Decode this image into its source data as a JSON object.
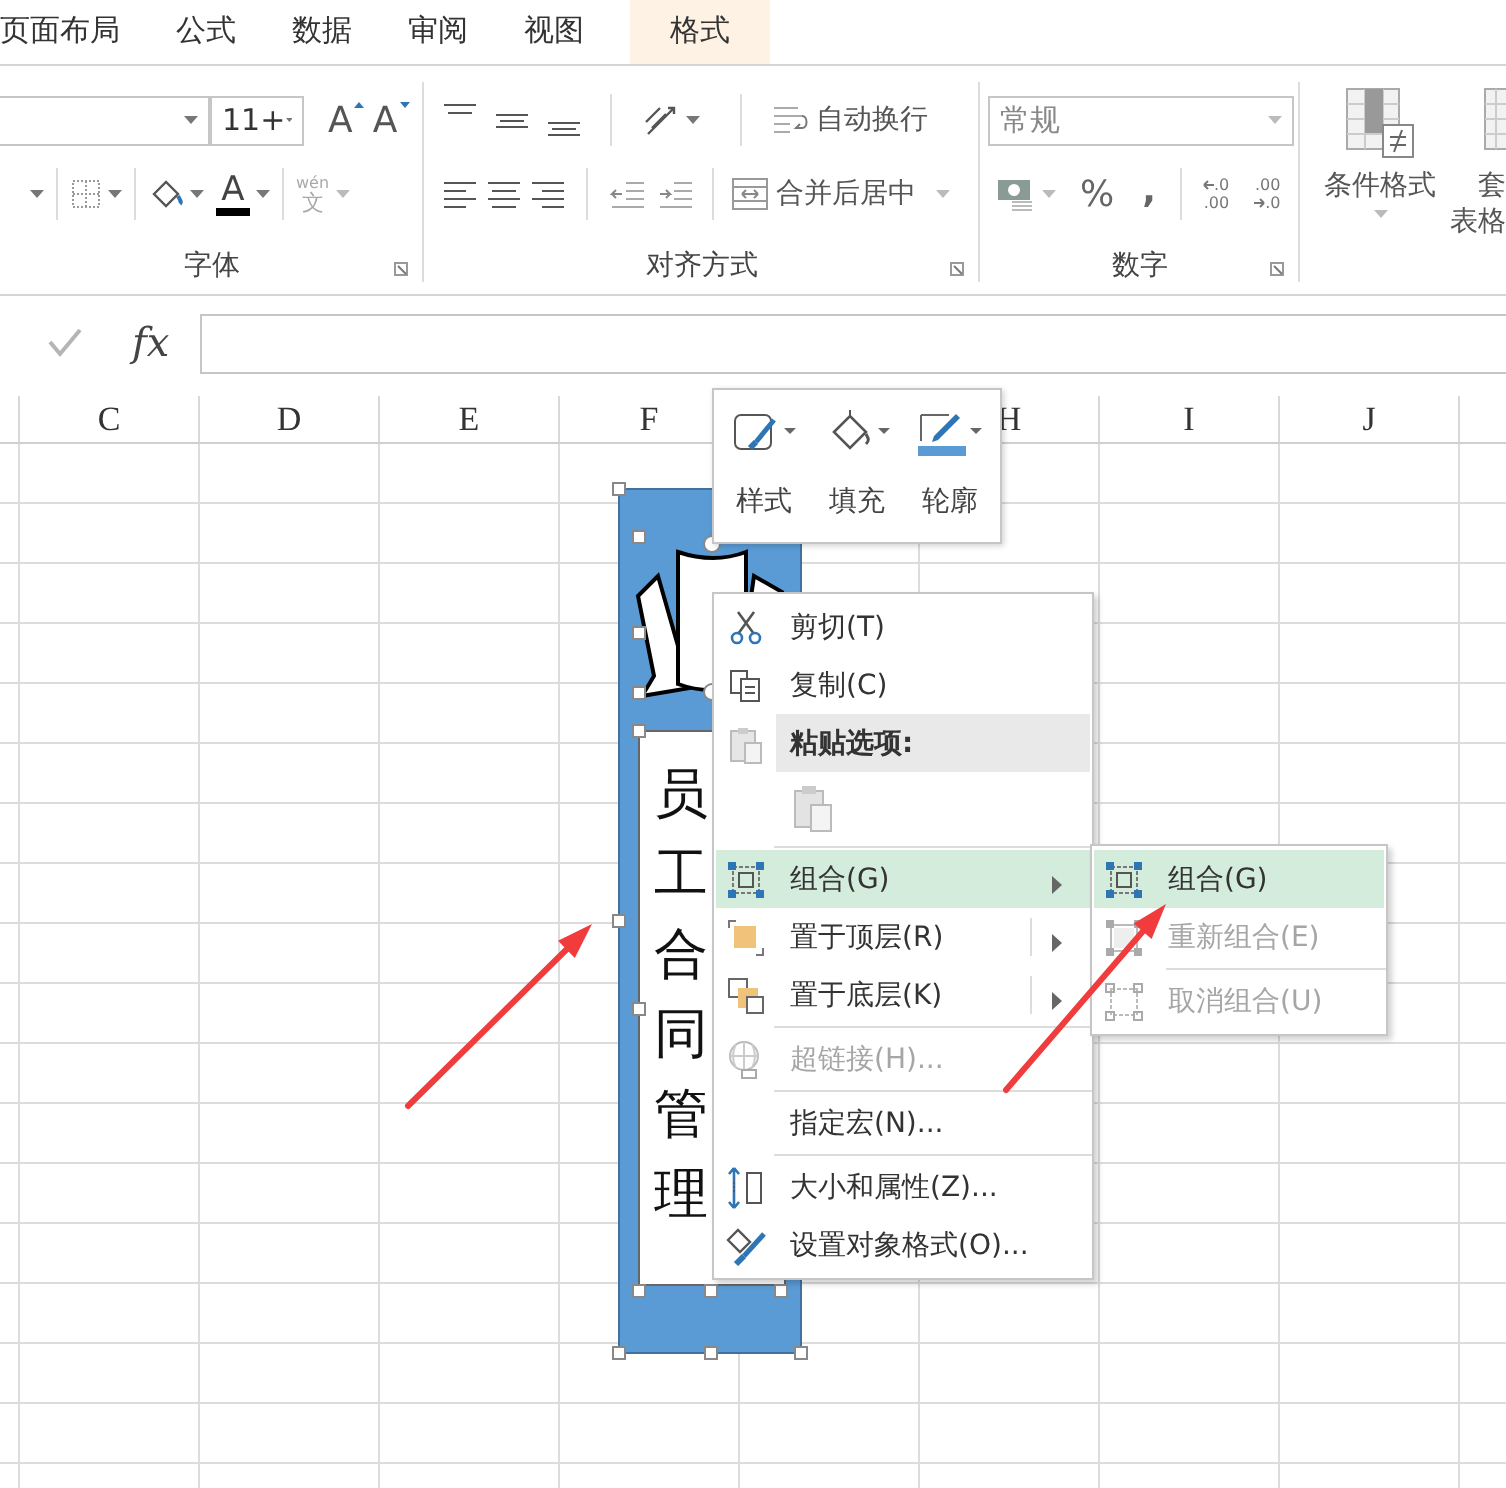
{
  "tabs": [
    {
      "label": "页面布局",
      "selected": false
    },
    {
      "label": "公式",
      "selected": false
    },
    {
      "label": "数据",
      "selected": false
    },
    {
      "label": "审阅",
      "selected": false
    },
    {
      "label": "视图",
      "selected": false
    },
    {
      "label": "格式",
      "selected": true
    }
  ],
  "ribbon": {
    "font_size": "11+",
    "grow_font": "A",
    "shrink_font": "A",
    "font_color": "A",
    "phonetic_guide": [
      "wén",
      "文"
    ],
    "wrap_text": "自动换行",
    "merge_center": "合并后居中",
    "number_format": "常规",
    "percent": "%",
    "comma": ",",
    "increase_decimal": [
      ".0",
      ".00"
    ],
    "decrease_decimal": [
      ".00",
      ".0"
    ],
    "conditional_formatting": "条件格式",
    "format_as_table": [
      "套",
      "表格"
    ],
    "group_labels": [
      "字体",
      "对齐方式",
      "数字"
    ]
  },
  "formula_bar": {
    "function_label": "fx"
  },
  "sheet": {
    "columns_left": [
      "C",
      "D",
      "E",
      "F"
    ],
    "columns_right": [
      "H",
      "I",
      "J"
    ],
    "shape_text": "员工合同管理"
  },
  "mini_toolbar": [
    {
      "label": "样式"
    },
    {
      "label": "填充"
    },
    {
      "label": "轮廓"
    }
  ],
  "context_menu": [
    {
      "kind": "item",
      "label": "剪切(T)",
      "selected": false,
      "disabled": false,
      "submenu": false
    },
    {
      "kind": "item",
      "label": "复制(C)",
      "selected": false,
      "disabled": false,
      "submenu": false
    },
    {
      "kind": "header",
      "label": "粘贴选项:"
    },
    {
      "kind": "paste_options"
    },
    {
      "kind": "separator"
    },
    {
      "kind": "item",
      "label": "组合(G)",
      "selected": true,
      "disabled": false,
      "submenu": true
    },
    {
      "kind": "item",
      "label": "置于顶层(R)",
      "selected": false,
      "disabled": false,
      "submenu": true
    },
    {
      "kind": "item",
      "label": "置于底层(K)",
      "selected": false,
      "disabled": false,
      "submenu": true
    },
    {
      "kind": "separator"
    },
    {
      "kind": "item",
      "label": "超链接(H)...",
      "selected": false,
      "disabled": true,
      "submenu": false
    },
    {
      "kind": "separator"
    },
    {
      "kind": "item",
      "label": "指定宏(N)...",
      "selected": false,
      "disabled": false,
      "submenu": false
    },
    {
      "kind": "separator"
    },
    {
      "kind": "item",
      "label": "大小和属性(Z)...",
      "selected": false,
      "disabled": false,
      "submenu": false
    },
    {
      "kind": "item",
      "label": "设置对象格式(O)...",
      "selected": false,
      "disabled": false,
      "submenu": false
    }
  ],
  "submenu": [
    {
      "kind": "item",
      "label": "组合(G)",
      "selected": true,
      "disabled": false
    },
    {
      "kind": "item",
      "label": "重新组合(E)",
      "selected": false,
      "disabled": true
    },
    {
      "kind": "separator"
    },
    {
      "kind": "item",
      "label": "取消组合(U)",
      "selected": false,
      "disabled": true
    }
  ]
}
